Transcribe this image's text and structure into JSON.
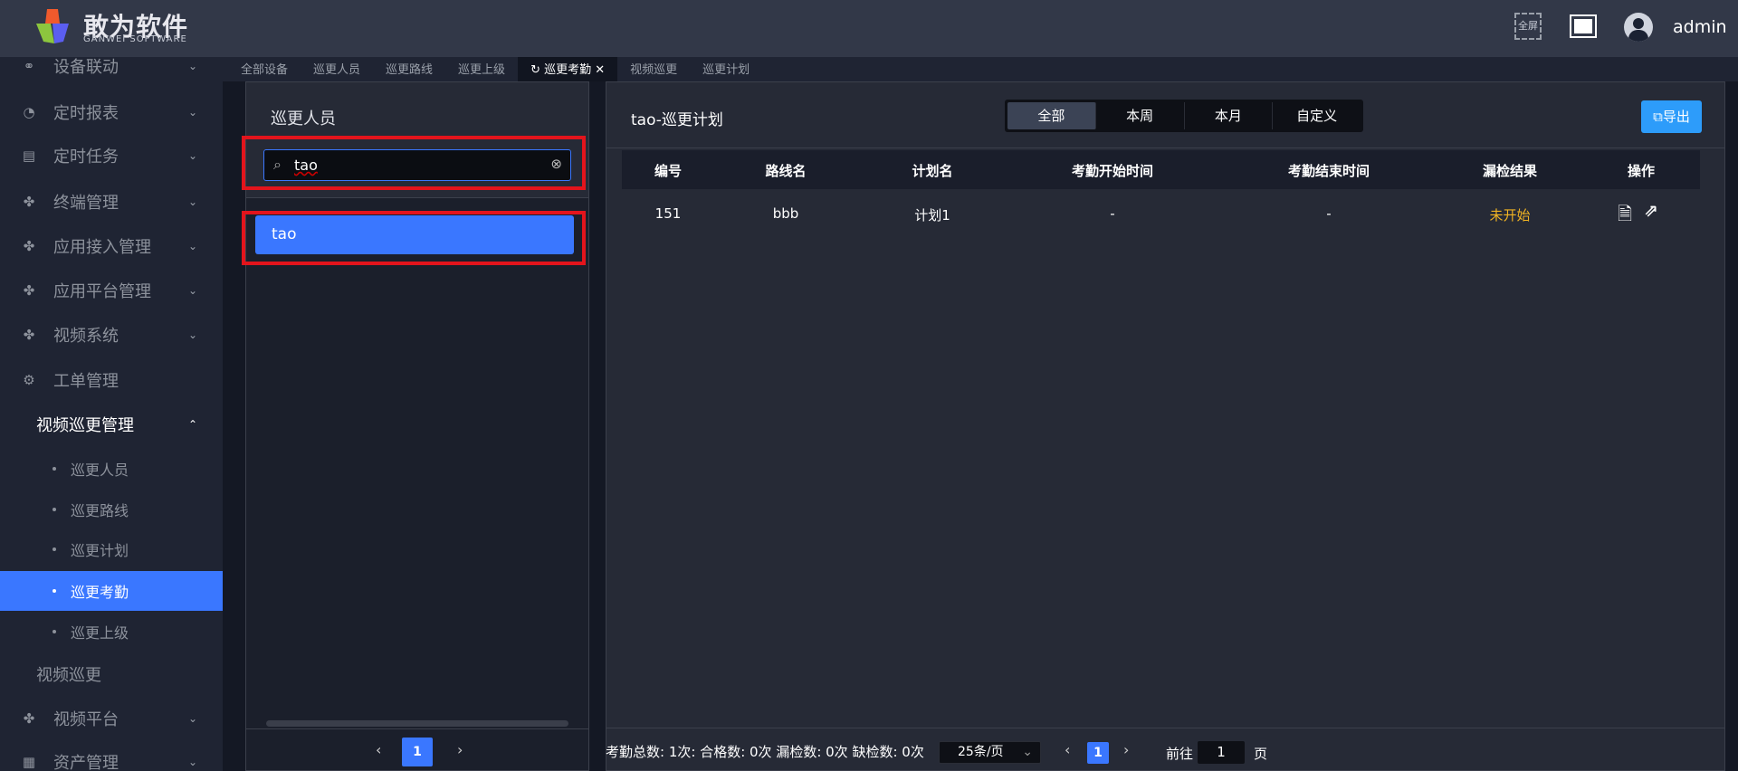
{
  "header": {
    "logo_cn": "敢为软件",
    "logo_en": "GANWEI SOFTWARE",
    "fullscreen_label": "全屏",
    "user": "admin"
  },
  "sidebar": {
    "items": [
      {
        "label": "设备联动",
        "icon": "link-icon",
        "chevron": "⌄"
      },
      {
        "label": "定时报表",
        "icon": "timer-icon",
        "chevron": "⌄"
      },
      {
        "label": "定时任务",
        "icon": "task-icon",
        "chevron": "⌄"
      },
      {
        "label": "终端管理",
        "icon": "grid-icon",
        "chevron": "⌄"
      },
      {
        "label": "应用接入管理",
        "icon": "grid-icon",
        "chevron": "⌄"
      },
      {
        "label": "应用平台管理",
        "icon": "grid-icon",
        "chevron": "⌄"
      },
      {
        "label": "视频系统",
        "icon": "grid-icon",
        "chevron": "⌄"
      },
      {
        "label": "工单管理",
        "icon": "gear-icon"
      },
      {
        "label": "视频巡更管理",
        "chevron": "⌃"
      }
    ],
    "sub_items": [
      "巡更人员",
      "巡更路线",
      "巡更计划",
      "巡更考勤",
      "巡更上级"
    ],
    "after": [
      {
        "label": "视频巡更"
      },
      {
        "label": "视频平台",
        "icon": "grid-icon",
        "chevron": "⌄"
      },
      {
        "label": "资产管理",
        "icon": "asset-icon",
        "chevron": "⌄"
      }
    ]
  },
  "tabs": [
    "全部设备",
    "巡更人员",
    "巡更路线",
    "巡更上级",
    "巡更考勤",
    "视频巡更",
    "巡更计划"
  ],
  "left": {
    "title": "巡更人员",
    "search_value": "tao",
    "results": [
      "tao"
    ],
    "page": "1"
  },
  "right": {
    "title": "tao-巡更计划",
    "segments": [
      "全部",
      "本周",
      "本月",
      "自定义"
    ],
    "export_label": "导出",
    "columns": [
      "编号",
      "路线名",
      "计划名",
      "考勤开始时间",
      "考勤结束时间",
      "漏检结果",
      "操作"
    ],
    "rows": [
      {
        "id": "151",
        "route": "bbb",
        "plan": "计划1",
        "start": "-",
        "end": "-",
        "result": "未开始"
      }
    ],
    "summary": "考勤总数: 1次: 合格数: 0次 漏检数: 0次 缺检数: 0次",
    "page_size": "25条/页",
    "page": "1",
    "goto_label": "前往",
    "goto_value": "1",
    "page_unit": "页"
  },
  "colors": {
    "accent": "#3a77ff",
    "warning": "#f0b323",
    "export": "#2d9cfa"
  }
}
